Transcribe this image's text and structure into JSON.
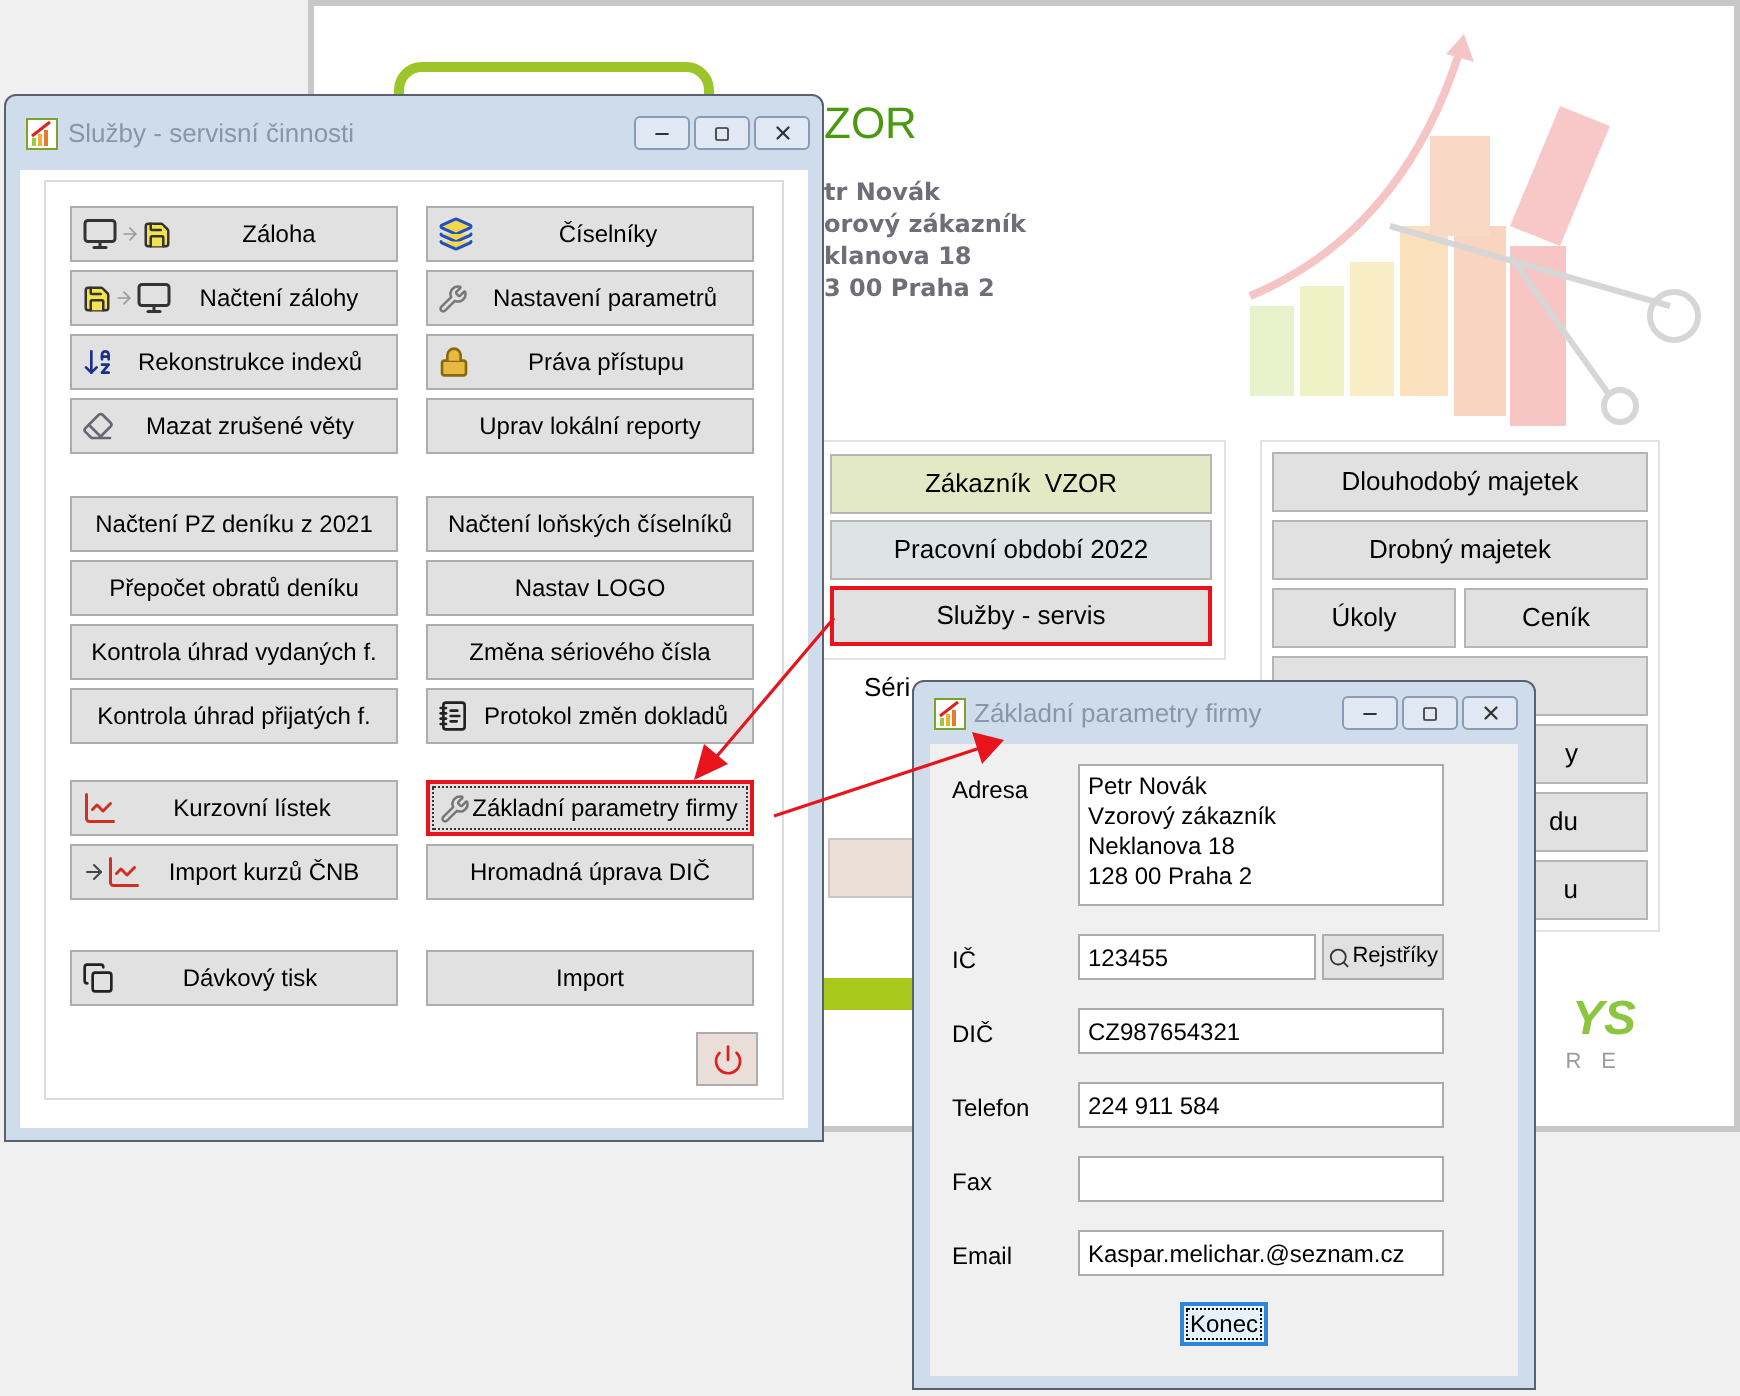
{
  "background_window": {
    "company_name": "ZOR",
    "address_lines": [
      "tr Novák",
      "orový zákazník",
      "klanova 18",
      "3 00 Praha 2"
    ],
    "left_buttons": [
      {
        "label": "Zákazník  VZOR",
        "kind": "customer",
        "highlighted": false
      },
      {
        "label": "Pracovní období 2022",
        "kind": "period",
        "highlighted": false
      },
      {
        "label": "Služby - servis",
        "kind": "plain",
        "highlighted": true
      }
    ],
    "serial_label": "Séri",
    "right_rows": [
      [
        {
          "label": "Dlouhodobý majetek"
        }
      ],
      [
        {
          "label": "Drobný majetek"
        }
      ],
      [
        {
          "label": "Úkoly"
        },
        {
          "label": "Ceník"
        }
      ]
    ],
    "covered_buttons": [
      {
        "kind": "blank"
      },
      {
        "kind": "text",
        "label": "y"
      },
      {
        "kind": "text",
        "label": "du"
      },
      {
        "kind": "text",
        "label": "u"
      }
    ],
    "logo": {
      "mark": "YS",
      "tagline": "RE"
    }
  },
  "services_window": {
    "title": "Služby - servisní činnosti",
    "groups": [
      [
        {
          "label": "Záloha",
          "kind": "backup",
          "highlighted": false
        },
        {
          "label": "Číselníky",
          "kind": "cards",
          "highlighted": false
        },
        {
          "label": "Načtení zálohy",
          "kind": "restore",
          "highlighted": false
        },
        {
          "label": "Nastavení parametrů",
          "kind": "wrench",
          "highlighted": false
        },
        {
          "label": "Rekonstrukce indexů",
          "kind": "sort",
          "highlighted": false
        },
        {
          "label": "Práva přístupu",
          "kind": "lock",
          "highlighted": false
        },
        {
          "label": "Mazat zrušené věty",
          "kind": "eraser",
          "highlighted": false
        },
        {
          "label": "Uprav lokální reporty",
          "highlighted": false
        }
      ],
      [
        {
          "label": "Načtení PZ deníku z 2021",
          "highlighted": false
        },
        {
          "label": "Načtení loňských číselníků",
          "highlighted": false
        },
        {
          "label": "Přepočet obratů deníku",
          "highlighted": false
        },
        {
          "label": "Nastav LOGO",
          "highlighted": false
        },
        {
          "label": "Kontrola úhrad vydaných f.",
          "highlighted": false
        },
        {
          "label": "Změna sériového čísla",
          "highlighted": false
        },
        {
          "label": "Kontrola úhrad přijatých f.",
          "highlighted": false
        },
        {
          "label": "Protokol změn dokladů",
          "kind": "notepad",
          "highlighted": false
        }
      ],
      [
        {
          "label": "Kurzovní lístek",
          "kind": "chart",
          "highlighted": false
        },
        {
          "label": "Základní parametry firmy",
          "kind": "wrench",
          "highlighted": true
        },
        {
          "label": "Import kurzů ČNB",
          "kind": "import-chart",
          "highlighted": false
        },
        {
          "label": "Hromadná úprava DIČ",
          "highlighted": false
        }
      ],
      [
        {
          "label": "Dávkový tisk",
          "kind": "pages",
          "highlighted": false
        },
        {
          "label": "Import",
          "highlighted": false
        }
      ]
    ]
  },
  "params_window": {
    "title": "Základní parametry firmy",
    "fields": [
      {
        "label": "Adresa",
        "kind": "multiline",
        "lines": [
          "Petr Novák",
          "Vzorový zákazník",
          "Neklanova 18",
          "128 00 Praha 2"
        ]
      },
      {
        "label": "IČ",
        "kind": "lookup",
        "value": "123455",
        "button": "Rejstříky"
      },
      {
        "label": "DIČ",
        "kind": "text",
        "value": "CZ987654321"
      },
      {
        "label": "Telefon",
        "kind": "text",
        "value": "224 911 584"
      },
      {
        "label": "Fax",
        "kind": "text"
      },
      {
        "label": "Email",
        "kind": "text",
        "value": "Kaspar.melichar.@seznam.cz"
      }
    ],
    "close_button": {
      "label": "Konec",
      "focused": true
    }
  }
}
